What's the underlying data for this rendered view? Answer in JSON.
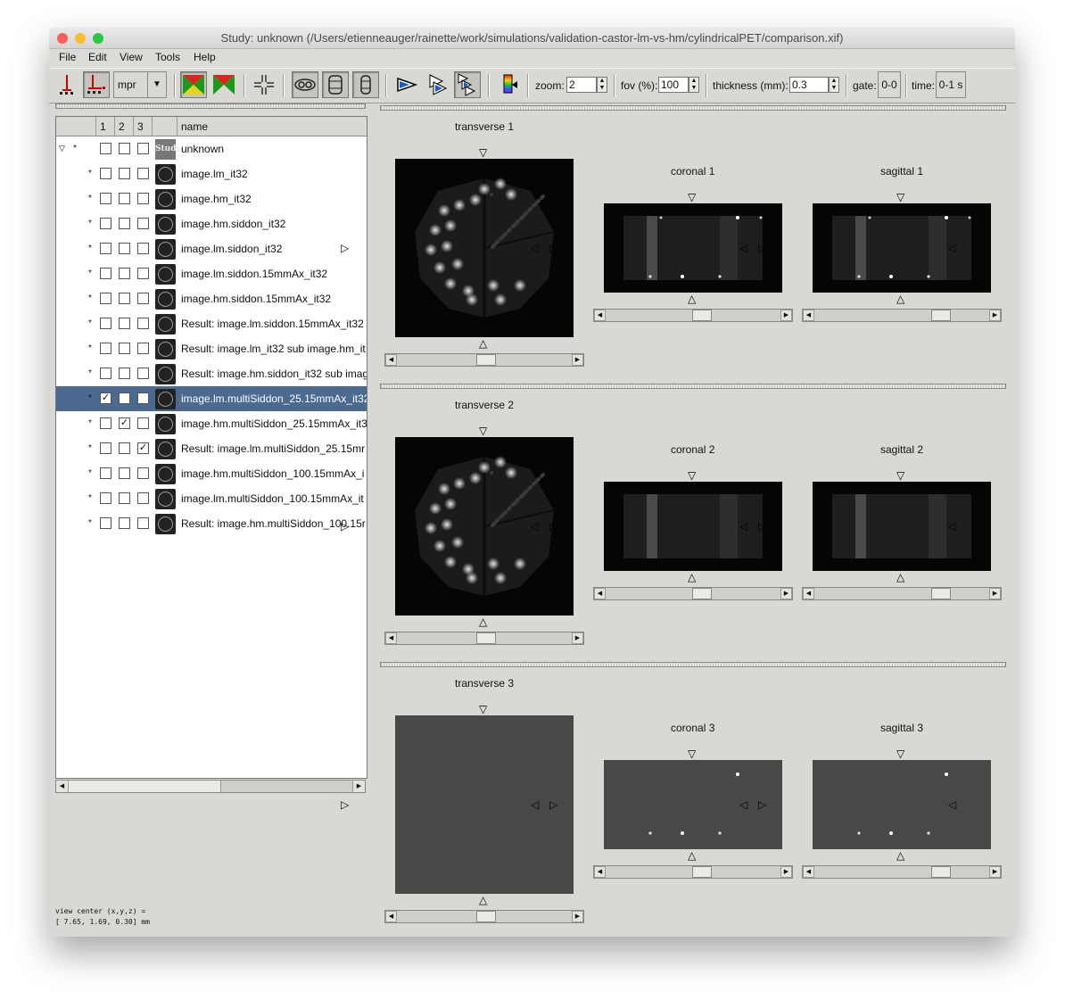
{
  "window": {
    "title": "Study: unknown (/Users/etienneauger/rainette/work/simulations/validation-castor-lm-vs-hm/cylindricalPET/comparison.xif)"
  },
  "menu": [
    "File",
    "Edit",
    "View",
    "Tools",
    "Help"
  ],
  "toolbar": {
    "mode_select": "mpr",
    "zoom_label": "zoom:",
    "zoom_value": "2",
    "fov_label": "fov (%):",
    "fov_value": "100",
    "thickness_label": "thickness (mm):",
    "thickness_value": "0.3",
    "gate_label": "gate:",
    "gate_value": "0-0",
    "time_label": "time:",
    "time_value": "0-1 s"
  },
  "study_list": {
    "headers": [
      "1",
      "2",
      "3",
      "",
      "name"
    ],
    "study_row": {
      "star": "*",
      "thumb_text": "Study",
      "name": "unknown"
    },
    "rows": [
      {
        "name": "image.lm_it32",
        "c1": false,
        "c2": false,
        "c3": false,
        "selected": false
      },
      {
        "name": "image.hm_it32",
        "c1": false,
        "c2": false,
        "c3": false,
        "selected": false
      },
      {
        "name": "image.hm.siddon_it32",
        "c1": false,
        "c2": false,
        "c3": false,
        "selected": false
      },
      {
        "name": "image.lm.siddon_it32",
        "c1": false,
        "c2": false,
        "c3": false,
        "selected": false
      },
      {
        "name": "image.lm.siddon.15mmAx_it32",
        "c1": false,
        "c2": false,
        "c3": false,
        "selected": false
      },
      {
        "name": "image.hm.siddon.15mmAx_it32",
        "c1": false,
        "c2": false,
        "c3": false,
        "selected": false
      },
      {
        "name": "Result: image.lm.siddon.15mmAx_it32",
        "c1": false,
        "c2": false,
        "c3": false,
        "selected": false
      },
      {
        "name": "Result: image.lm_it32 sub image.hm_it",
        "c1": false,
        "c2": false,
        "c3": false,
        "selected": false
      },
      {
        "name": "Result: image.hm.siddon_it32 sub imag",
        "c1": false,
        "c2": false,
        "c3": false,
        "selected": false
      },
      {
        "name": "image.lm.multiSiddon_25.15mmAx_it32",
        "c1": true,
        "c2": false,
        "c3": false,
        "selected": true
      },
      {
        "name": "image.hm.multiSiddon_25.15mmAx_it3",
        "c1": false,
        "c2": true,
        "c3": false,
        "selected": false
      },
      {
        "name": "Result: image.lm.multiSiddon_25.15mr",
        "c1": false,
        "c2": false,
        "c3": true,
        "selected": false
      },
      {
        "name": "image.hm.multiSiddon_100.15mmAx_i",
        "c1": false,
        "c2": false,
        "c3": false,
        "selected": false
      },
      {
        "name": "image.lm.multiSiddon_100.15mmAx_it",
        "c1": false,
        "c2": false,
        "c3": false,
        "selected": false
      },
      {
        "name": "Result: image.hm.multiSiddon_100.15r",
        "c1": false,
        "c2": false,
        "c3": false,
        "selected": false
      }
    ]
  },
  "view_center": {
    "line1": "view center (x,y,z) =",
    "line2": "[ 7.65, 1.69, 0.30] mm"
  },
  "views": [
    {
      "transverse": "transverse 1",
      "coronal": "coronal 1",
      "sagittal": "sagittal 1"
    },
    {
      "transverse": "transverse 2",
      "coronal": "coronal 2",
      "sagittal": "sagittal 2"
    },
    {
      "transverse": "transverse 3",
      "coronal": "coronal 3",
      "sagittal": "sagittal 3"
    }
  ],
  "colors": {
    "selection": "#4a6a8f",
    "window_bg": "#d9d8d4",
    "close": "#fc5f57",
    "minimize": "#fdbc2e",
    "zoom": "#28c840"
  }
}
